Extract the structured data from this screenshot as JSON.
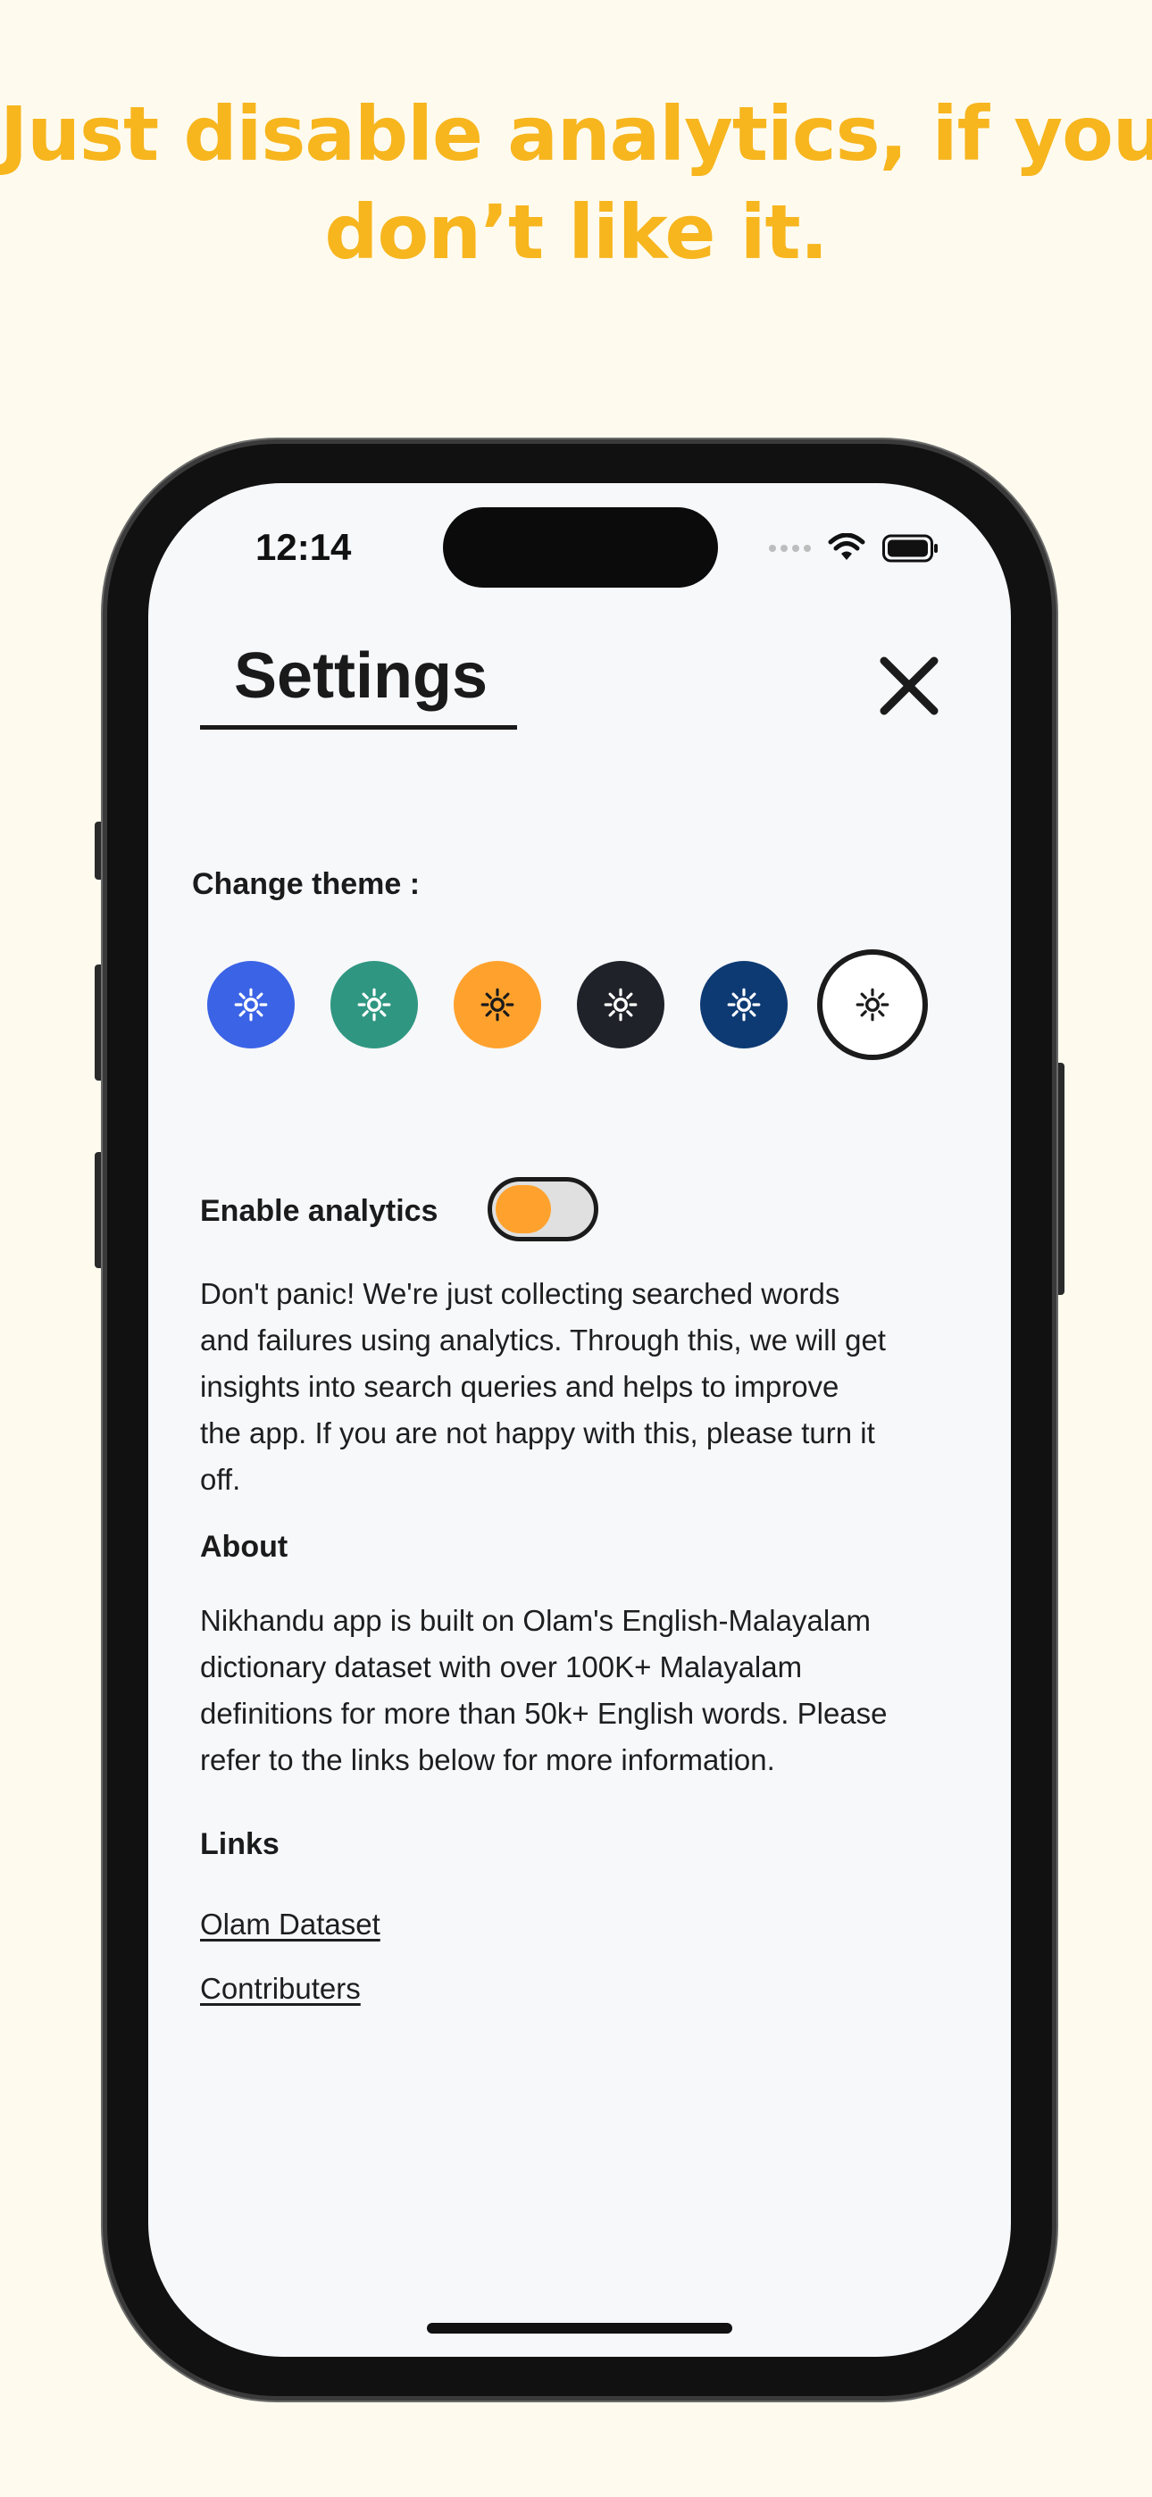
{
  "headline": {
    "line1": "Just disable analytics, if you",
    "line2": "don’t like it."
  },
  "status_bar": {
    "time": "12:14",
    "icons": [
      "signal-dots-icon",
      "wifi-icon",
      "battery-icon"
    ]
  },
  "settings": {
    "title": "Settings",
    "close_icon": "close-icon",
    "change_theme_label": "Change theme :",
    "themes": [
      {
        "name": "blue",
        "color": "#3b63e6",
        "icon_color": "#ffffff"
      },
      {
        "name": "teal",
        "color": "#2f9682",
        "icon_color": "#ffffff"
      },
      {
        "name": "orange",
        "color": "#ffa22d",
        "icon_color": "#1b1b1b"
      },
      {
        "name": "dark",
        "color": "#1f2229",
        "icon_color": "#ffffff"
      },
      {
        "name": "navy",
        "color": "#0d3a73",
        "icon_color": "#ffffff"
      },
      {
        "name": "light",
        "color": "#ffffff",
        "icon_color": "#1b1b1b",
        "selected": true
      }
    ],
    "analytics": {
      "label": "Enable analytics",
      "enabled": true,
      "accent": "#ffa22d",
      "description_lines": [
        "Don't panic! We're just collecting searched words",
        "and failures using analytics. Through this, we will get",
        "insights into search queries and helps to improve",
        "the app. If you are not happy with this, please turn it",
        "off."
      ]
    },
    "about": {
      "heading": "About",
      "lines": [
        "Nikhandu app is built on Olam's English-Malayalam",
        "dictionary dataset with over 100K+ Malayalam",
        "definitions for more than 50k+ English words. Please",
        "refer to the links below for more information."
      ]
    },
    "links": {
      "heading": "Links",
      "items": [
        "Olam Dataset",
        "Contributers"
      ]
    }
  }
}
